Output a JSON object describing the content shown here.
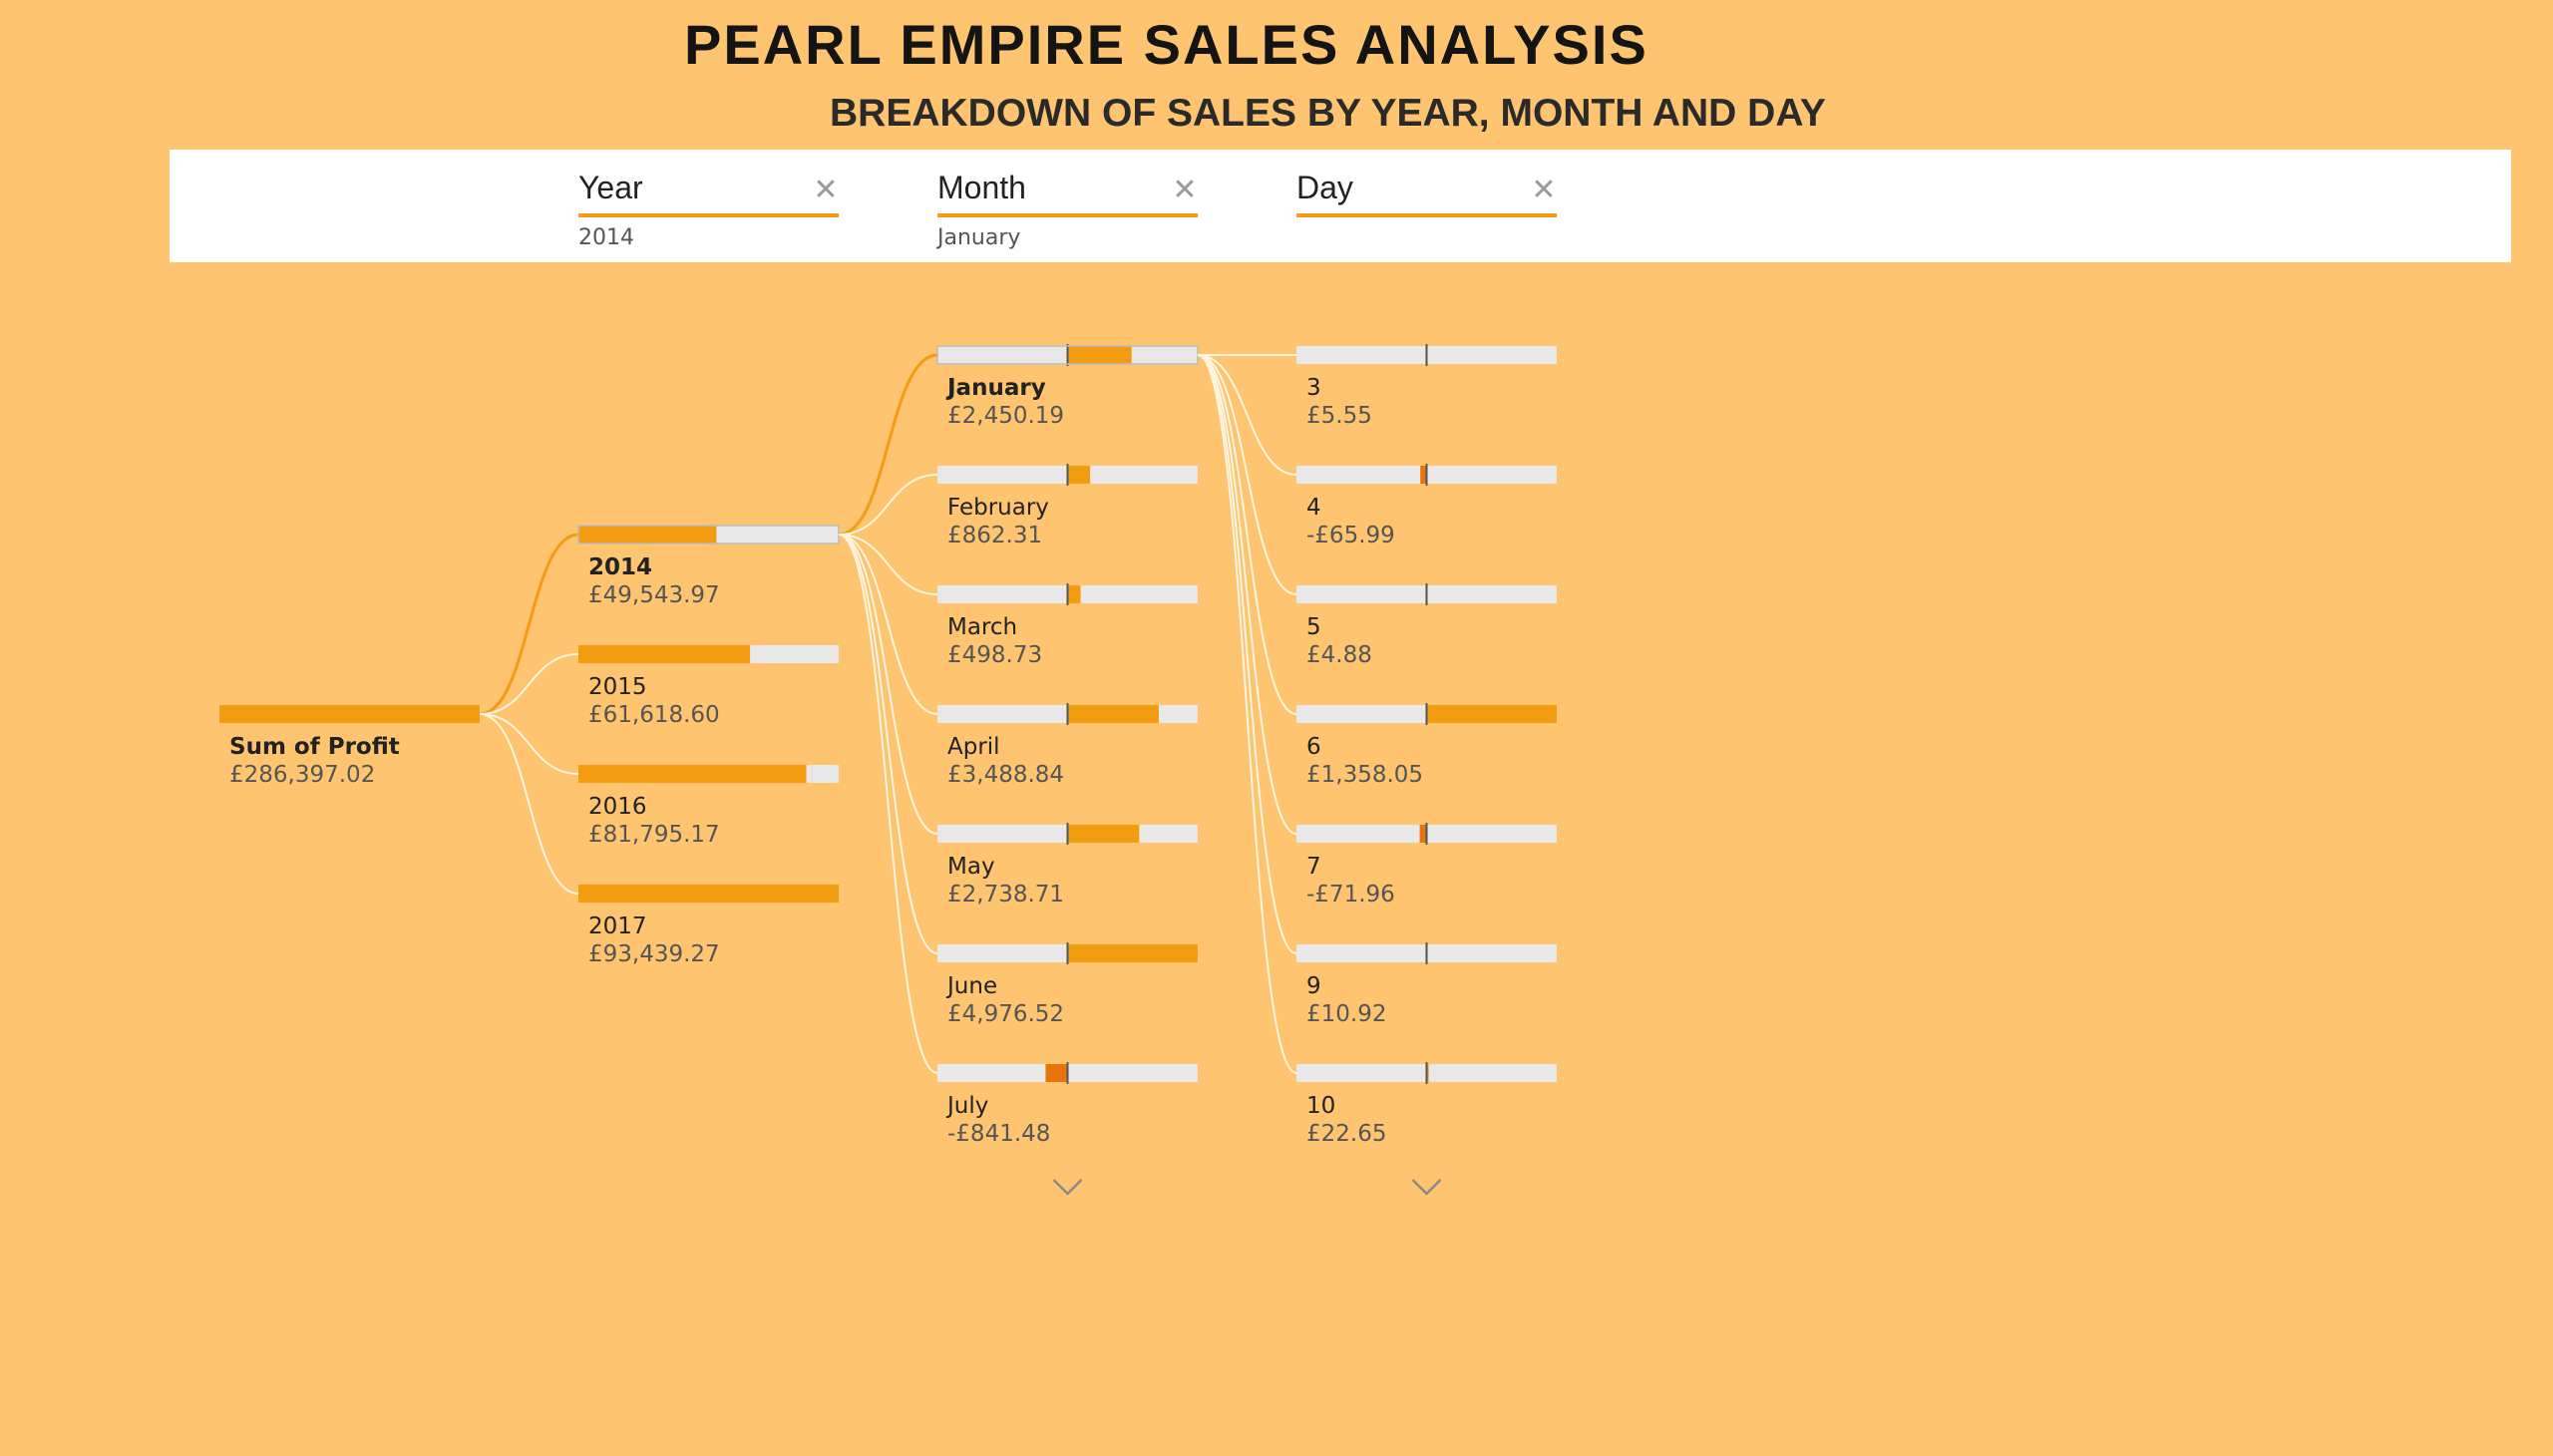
{
  "title": "PEARL EMPIRE SALES ANALYSIS",
  "subtitle": "BREAKDOWN OF SALES BY YEAR, MONTH AND DAY",
  "colors": {
    "background": "#FEC46F",
    "accent": "#F39C12",
    "negative": "#E8730C",
    "bar_track": "#E8E8E8"
  },
  "filters": [
    {
      "name": "Year",
      "value": "2014",
      "icon": "close-icon"
    },
    {
      "name": "Month",
      "value": "January",
      "icon": "close-icon"
    },
    {
      "name": "Day",
      "value": "",
      "icon": "close-icon"
    }
  ],
  "tree": {
    "root": {
      "label": "Sum of Profit",
      "value": "£286,397.02",
      "amount": 286397.02
    },
    "years": [
      {
        "label": "2014",
        "value": "£49,543.97",
        "amount": 49543.97,
        "selected": true
      },
      {
        "label": "2015",
        "value": "£61,618.60",
        "amount": 61618.6
      },
      {
        "label": "2016",
        "value": "£81,795.17",
        "amount": 81795.17
      },
      {
        "label": "2017",
        "value": "£93,439.27",
        "amount": 93439.27
      }
    ],
    "months": [
      {
        "label": "January",
        "value": "£2,450.19",
        "amount": 2450.19,
        "selected": true
      },
      {
        "label": "February",
        "value": "£862.31",
        "amount": 862.31
      },
      {
        "label": "March",
        "value": "£498.73",
        "amount": 498.73
      },
      {
        "label": "April",
        "value": "£3,488.84",
        "amount": 3488.84
      },
      {
        "label": "May",
        "value": "£2,738.71",
        "amount": 2738.71
      },
      {
        "label": "June",
        "value": "£4,976.52",
        "amount": 4976.52
      },
      {
        "label": "July",
        "value": "-£841.48",
        "amount": -841.48
      }
    ],
    "days": [
      {
        "label": "3",
        "value": "£5.55",
        "amount": 5.55
      },
      {
        "label": "4",
        "value": "-£65.99",
        "amount": -65.99
      },
      {
        "label": "5",
        "value": "£4.88",
        "amount": 4.88
      },
      {
        "label": "6",
        "value": "£1,358.05",
        "amount": 1358.05
      },
      {
        "label": "7",
        "value": "-£71.96",
        "amount": -71.96
      },
      {
        "label": "9",
        "value": "£10.92",
        "amount": 10.92
      },
      {
        "label": "10",
        "value": "£22.65",
        "amount": 22.65
      }
    ],
    "more_icon": "chevron-down-icon"
  }
}
